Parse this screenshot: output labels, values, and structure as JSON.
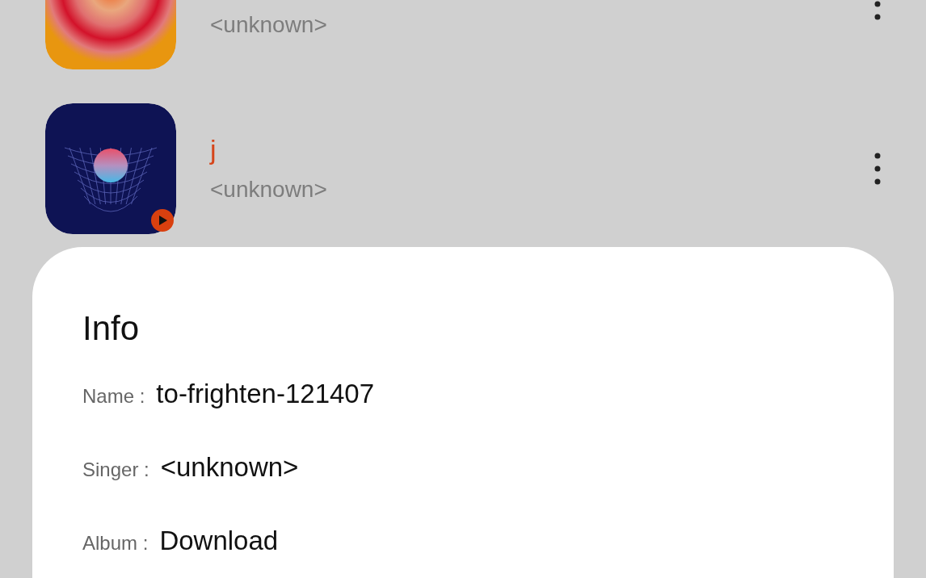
{
  "songs": [
    {
      "kind": "rings",
      "subtitle": "<unknown>",
      "playing": false
    },
    {
      "kind": "grid",
      "title": "j",
      "subtitle": "<unknown>",
      "playing": true
    }
  ],
  "info": {
    "title": "Info",
    "fields": [
      {
        "label": "Name :",
        "value": "to-frighten-121407"
      },
      {
        "label": "Singer :",
        "value": "<unknown>"
      },
      {
        "label": "Album :",
        "value": "Download"
      }
    ]
  }
}
